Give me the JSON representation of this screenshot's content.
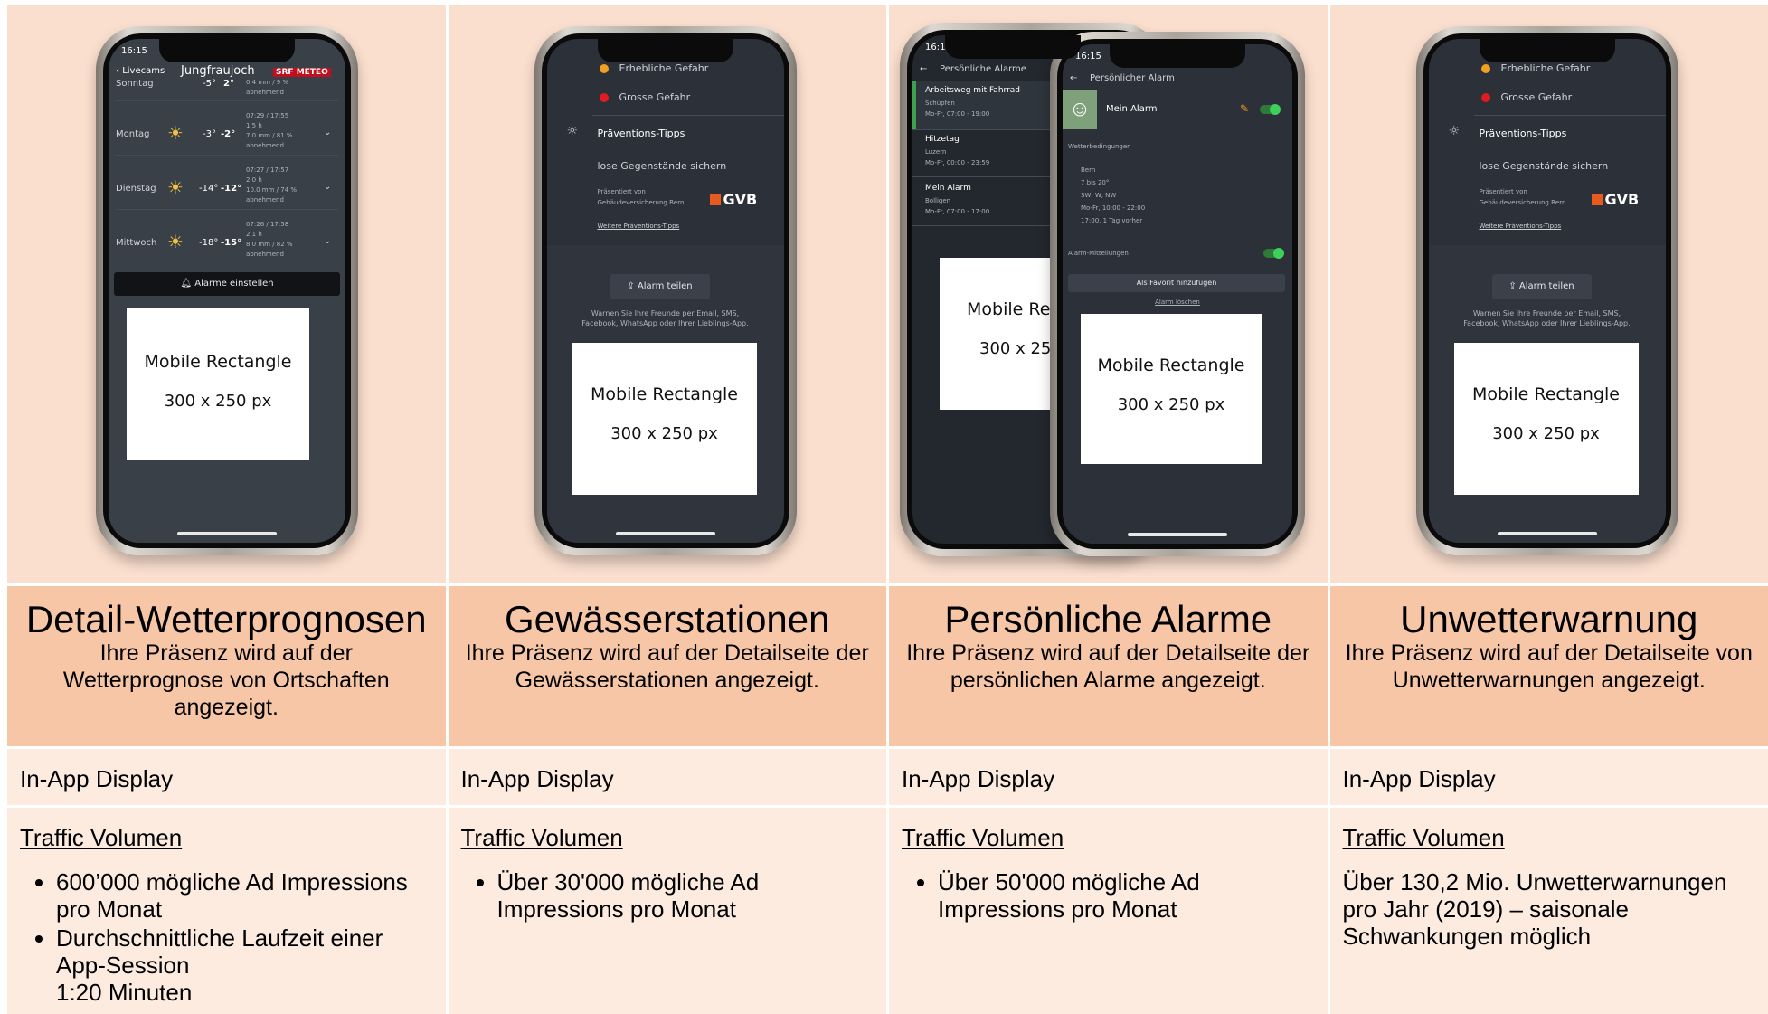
{
  "columns": [
    {
      "title": "Detail-Wetterprognosen",
      "subtitle": "Ihre Präsenz wird auf der Wetterprognose von Ortschaften angezeigt.",
      "display": "In-App Display",
      "traffic_label": "Traffic Volumen",
      "bullets": [
        "600’000 mögliche Ad Impressions pro Monat",
        "Durchschnittliche Laufzeit einer App-Session",
        "1:20 Minuten"
      ],
      "phone": {
        "time": "16:15",
        "back": "Livecams",
        "location": "Jungfraujoch",
        "logo": "SRF METEO",
        "days": [
          {
            "day": "Sonntag",
            "temp_hi": "-5°",
            "temp_lo": "2°",
            "detail": [
              "0.4 mm / 9 %",
              "abnehmend"
            ]
          },
          {
            "day": "Montag",
            "temp_hi": "-3°",
            "temp_lo": "-2°",
            "detail": [
              "07:29 / 17:55",
              "1.5 h",
              "7.0 mm / 81 %",
              "abnehmend"
            ]
          },
          {
            "day": "Dienstag",
            "temp_hi": "-14°",
            "temp_lo": "-12°",
            "detail": [
              "07:27 / 17:57",
              "2.0 h",
              "10.0 mm / 74 %",
              "abnehmend"
            ]
          },
          {
            "day": "Mittwoch",
            "temp_hi": "-18°",
            "temp_lo": "-15°",
            "detail": [
              "07:26 / 17:58",
              "2.1 h",
              "8.0 mm / 82 %",
              "abnehmend"
            ]
          }
        ],
        "alarm_button": "Alarme einstellen",
        "ad_line1": "Mobile Rectangle",
        "ad_line2": "300 x 250 px"
      }
    },
    {
      "title": "Gewässerstationen",
      "subtitle": "Ihre Präsenz wird auf der Detailseite der Gewässerstationen angezeigt.",
      "display": "In-App Display",
      "traffic_label": "Traffic Volumen",
      "bullets": [
        "Über 30'000 mögliche Ad Impressions pro Monat"
      ],
      "phone": {
        "levels": [
          "Erhebliche Gefahr",
          "Grosse Gefahr"
        ],
        "tips_title": "Präventions-Tipps",
        "tip": "lose Gegenstände sichern",
        "sponsor": [
          "Präsentiert von",
          "Gebäudeversicherung Bern"
        ],
        "sponsor_logo": "GVB",
        "more_link": "Weitere Präventions-Tipps",
        "share_button": "Alarm teilen",
        "share_text": [
          "Warnen Sie Ihre Freunde per Email, SMS,",
          "Facebook, WhatsApp oder Ihrer Lieblings-App."
        ],
        "ad_line1": "Mobile Rectangle",
        "ad_line2": "300 x 250 px"
      }
    },
    {
      "title": "Persönliche Alarme",
      "subtitle": "Ihre Präsenz wird auf der Detailseite der persönlichen Alarme angezeigt.",
      "display": "In-App Display",
      "traffic_label": "Traffic Volumen",
      "bullets": [
        "Über 50'000 mögliche Ad Impressions pro Monat"
      ],
      "phone_back": {
        "time": "16:15",
        "header": "Persönliche Alarme",
        "items": [
          {
            "name": "Arbeitsweg mit Fahrrad",
            "place": "Schüpfen",
            "time": "Mo-Fr, 07:00 - 19:00"
          },
          {
            "name": "Hitzetag",
            "place": "Luzern",
            "time": "Mo-Fr, 00:00 - 23:59"
          },
          {
            "name": "Mein Alarm",
            "place": "Bolligen",
            "time": "Mo-Fr, 07:00 - 17:00"
          }
        ],
        "ad_line1": "Mobile Rect",
        "ad_line2": "300 x 250"
      },
      "phone_front": {
        "time": "16:15",
        "header": "Persönlicher Alarm",
        "alarm_name": "Mein Alarm",
        "conditions_title": "Wetterbedingungen",
        "conditions": [
          "Bern",
          "7 bis 20°",
          "SW, W, NW",
          "Mo-Fr, 10:00 - 22:00",
          "17:00, 1 Tag vorher"
        ],
        "notifications": "Alarm-Mitteilungen",
        "favorite_button": "Als Favorit hinzufügen",
        "delete_link": "Alarm löschen",
        "ad_line1": "Mobile Rectangle",
        "ad_line2": "300 x 250 px"
      }
    },
    {
      "title": "Unwetterwarnung",
      "subtitle": "Ihre Präsenz wird auf der Detailseite von Unwetterwarnungen angezeigt.",
      "display": "In-App Display",
      "traffic_label": "Traffic Volumen",
      "paragraph": "Über 130,2 Mio. Unwetterwarnungen pro Jahr (2019) – saisonale Schwankungen möglich",
      "phone": {
        "levels": [
          "Erhebliche Gefahr",
          "Grosse Gefahr"
        ],
        "tips_title": "Präventions-Tipps",
        "tip": "lose Gegenstände sichern",
        "sponsor": [
          "Präsentiert von",
          "Gebäudeversicherung Bern"
        ],
        "sponsor_logo": "GVB",
        "more_link": "Weitere Präventions-Tipps",
        "share_button": "Alarm teilen",
        "share_text": [
          "Warnen Sie Ihre Freunde per Email, SMS,",
          "Facebook, WhatsApp oder Ihrer Lieblings-App."
        ],
        "ad_line1": "Mobile Rectangle",
        "ad_line2": "300 x 250 px"
      }
    }
  ],
  "colors": {
    "image_bg": "#fbdfce",
    "header_bg": "#f6c6a6",
    "body_bg": "#fdebe0",
    "app_bg": "#2b3039",
    "orange": "#f0a020",
    "red": "#e01b22",
    "green": "#3fd05a"
  }
}
